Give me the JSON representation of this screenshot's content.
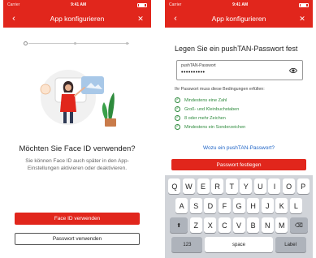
{
  "left_screen": {
    "status": {
      "carrier": "Carrier",
      "time": "9:41 AM"
    },
    "nav": {
      "title": "App konfigurieren",
      "back_icon": "‹",
      "close_icon": "✕"
    },
    "heading": "Möchten Sie Face ID verwenden?",
    "description": "Sie können Face ID auch später in den App-Einstellungen aktivieren oder deaktivieren.",
    "primary_button": "Face ID verwenden",
    "secondary_button": "Passwort verwenden"
  },
  "right_screen": {
    "status": {
      "carrier": "Carrier",
      "time": "9:41 AM"
    },
    "nav": {
      "title": "App konfigurieren",
      "back_icon": "‹",
      "close_icon": "✕"
    },
    "heading": "Legen Sie ein pushTAN-Passwort fest",
    "password_field": {
      "label": "pushTAN-Passwort",
      "value": "••••••••••"
    },
    "rules_intro": "Ihr Passwort muss diese Bedingungen erfüllen:",
    "rules": [
      "Mindestens eine Zahl",
      "Groß- und Kleinbuchstaben",
      "8 oder mehr Zeichen",
      "Mindestens ein Sonderzeichen"
    ],
    "link": "Wozu ein pushTAN-Passwort?",
    "primary_button": "Passwort festlegen",
    "keyboard": {
      "row1": [
        "Q",
        "W",
        "E",
        "R",
        "T",
        "Y",
        "U",
        "I",
        "O",
        "P"
      ],
      "row2": [
        "A",
        "S",
        "D",
        "F",
        "G",
        "H",
        "J",
        "K",
        "L"
      ],
      "row3": [
        "Z",
        "X",
        "C",
        "V",
        "B",
        "N",
        "M"
      ],
      "shift": "⬆",
      "backspace": "⌫",
      "numbers": "123",
      "space": "space",
      "return": "Label"
    }
  },
  "colors": {
    "brand_red": "#e1261c",
    "rule_green": "#2e8b3d",
    "link_blue": "#1d63c6"
  }
}
